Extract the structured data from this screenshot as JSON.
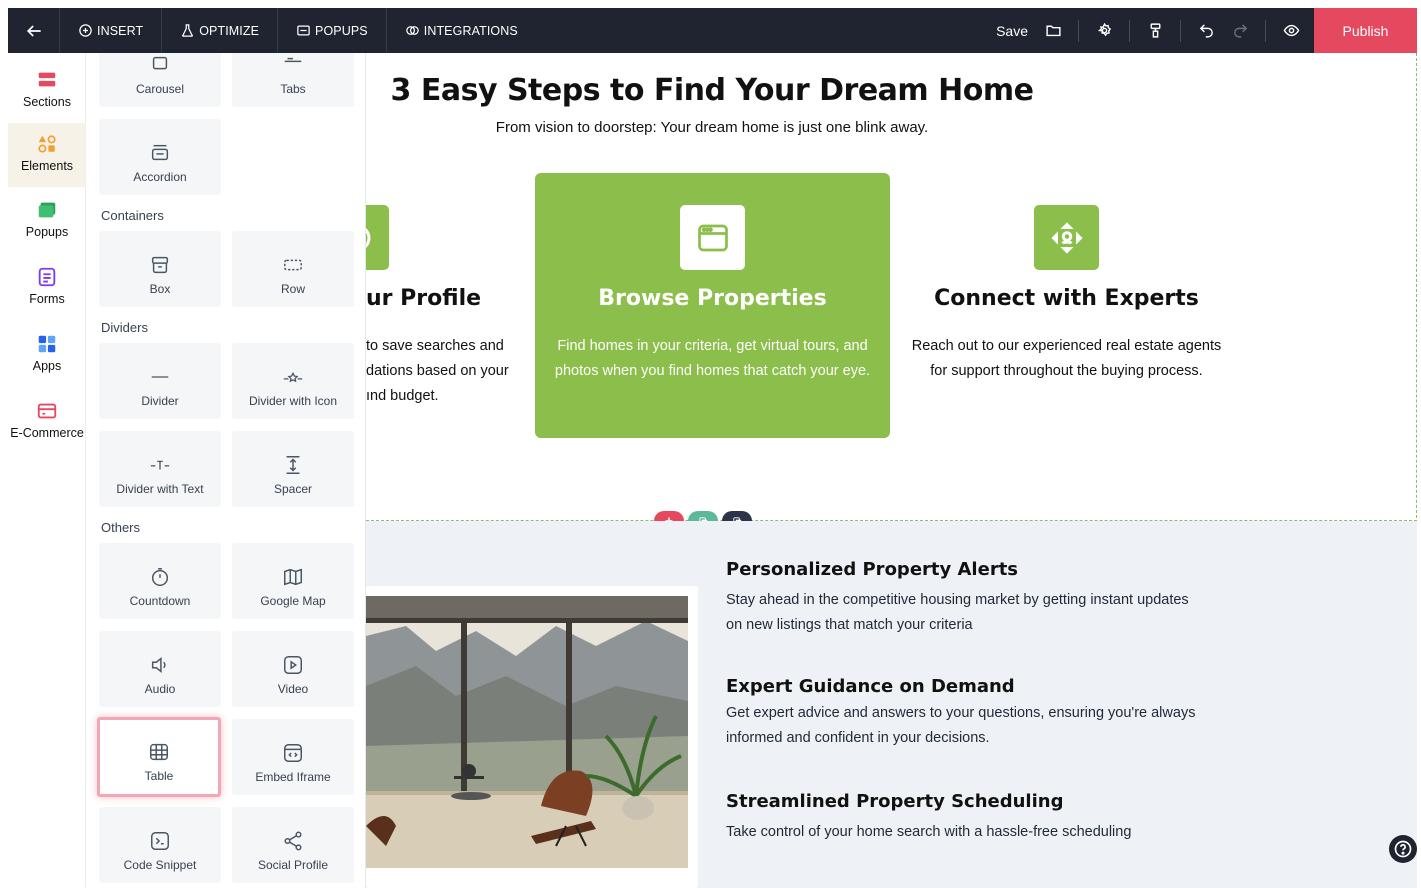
{
  "topbar": {
    "nav": [
      {
        "label": "INSERT",
        "icon": "plus-circle-icon"
      },
      {
        "label": "OPTIMIZE",
        "icon": "flask-icon"
      },
      {
        "label": "POPUPS",
        "icon": "popup-window-icon"
      },
      {
        "label": "INTEGRATIONS",
        "icon": "integrations-icon"
      }
    ],
    "save_label": "Save",
    "publish_label": "Publish",
    "colors": {
      "bar": "#1f2430",
      "publish": "#e5495f"
    }
  },
  "rail": {
    "items": [
      {
        "label": "Sections",
        "icon": "sections-icon",
        "active": false
      },
      {
        "label": "Elements",
        "icon": "elements-icon",
        "active": true
      },
      {
        "label": "Popups",
        "icon": "popups-icon",
        "active": false
      },
      {
        "label": "Forms",
        "icon": "forms-icon",
        "active": false
      },
      {
        "label": "Apps",
        "icon": "apps-icon",
        "active": false
      },
      {
        "label": "E-Commerce",
        "icon": "ecommerce-icon",
        "active": false
      }
    ]
  },
  "panel": {
    "cards_top": [
      "Carousel",
      "Tabs",
      "Accordion"
    ],
    "containers_label": "Containers",
    "containers": [
      "Box",
      "Row"
    ],
    "dividers_label": "Dividers",
    "dividers": [
      "Divider",
      "Divider with Icon",
      "Divider with Text",
      "Spacer"
    ],
    "others_label": "Others",
    "others": [
      "Countdown",
      "Google Map",
      "Audio",
      "Video",
      "Table",
      "Embed Iframe",
      "Code Snippet",
      "Social Profile"
    ]
  },
  "canvas": {
    "heading": "3 Easy Steps to Find Your Dream Home",
    "subheading": "From vision to doorstep: Your dream home is just one blink away.",
    "steps": [
      {
        "title": "ur Profile",
        "desc": [
          "to save searches and",
          "dations based on your",
          "ınd budget."
        ]
      },
      {
        "title": "Browse Properties",
        "desc": "Find homes in your criteria, get virtual tours, and photos when you find homes that catch your eye."
      },
      {
        "title": "Connect with Experts",
        "desc": "Reach out to our experienced real estate agents for support throughout the buying process."
      }
    ],
    "accent": "#8bbe4a",
    "section_controls": [
      {
        "icon": "plus-icon",
        "color": "#e5495f"
      },
      {
        "icon": "copy-icon",
        "color": "#5bb99a"
      },
      {
        "icon": "duplicate-icon",
        "color": "#2c3447"
      }
    ],
    "features": [
      {
        "title": "Personalized Property Alerts",
        "desc": "Stay ahead in the competitive housing market by getting instant updates on new listings that match your criteria"
      },
      {
        "title": "Expert Guidance on Demand",
        "desc": "Get expert advice and answers to your questions, ensuring you're always informed and confident in your decisions."
      },
      {
        "title": "Streamlined Property Scheduling",
        "desc": "Take control of your home search with a hassle-free scheduling"
      }
    ]
  }
}
